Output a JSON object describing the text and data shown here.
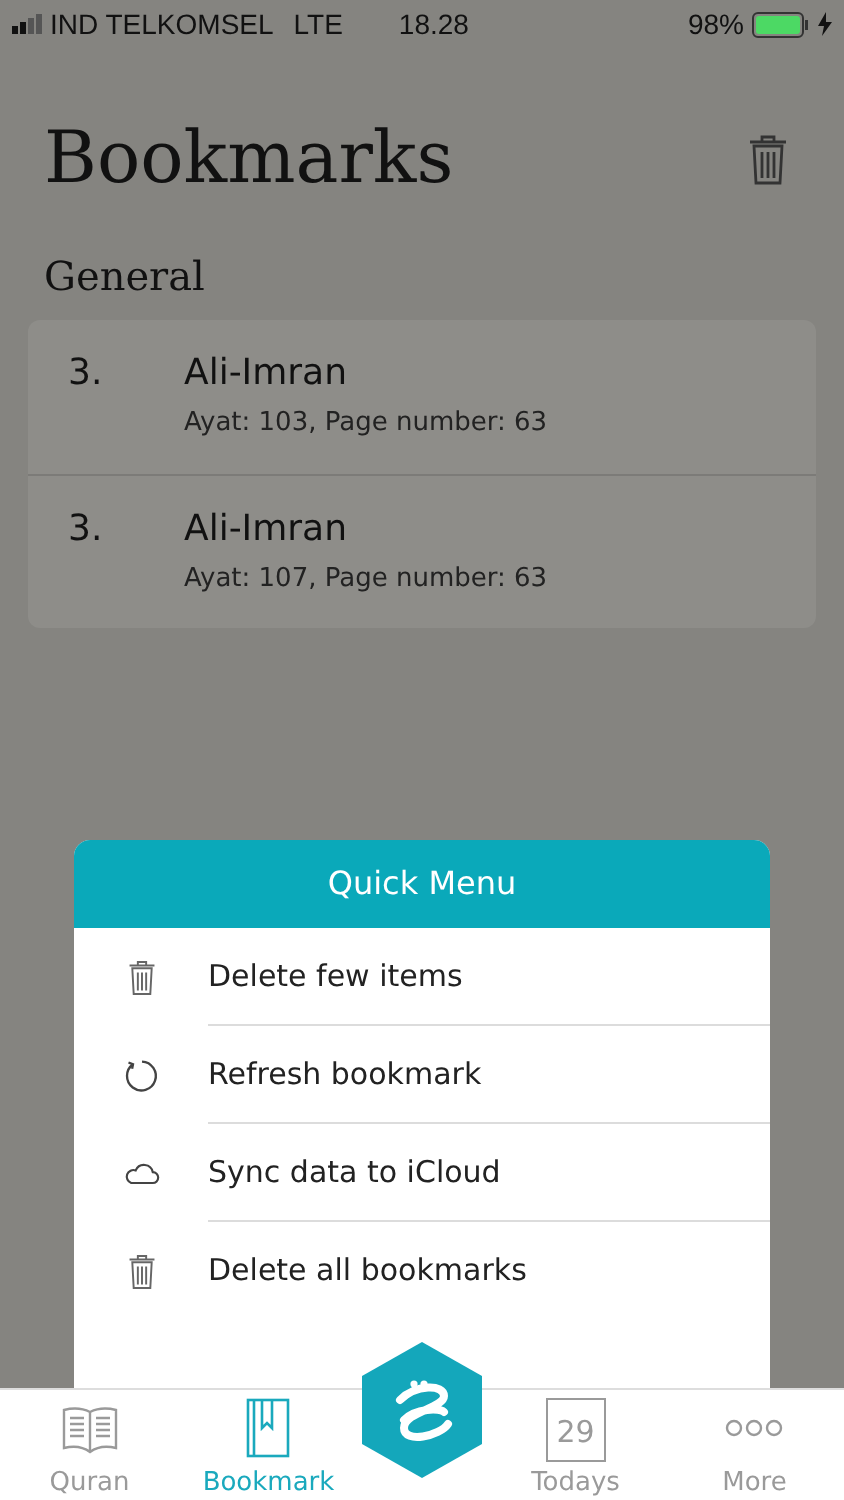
{
  "status_bar": {
    "carrier": "IND TELKOMSEL",
    "network": "LTE",
    "time": "18.28",
    "battery": "98%"
  },
  "header": {
    "title": "Bookmarks"
  },
  "section": {
    "title": "General"
  },
  "bookmarks": [
    {
      "number": "3.",
      "surah": "Ali-Imran",
      "detail": "Ayat: 103, Page number: 63"
    },
    {
      "number": "3.",
      "surah": "Ali-Imran",
      "detail": "Ayat: 107, Page number: 63"
    }
  ],
  "quick_menu": {
    "title": "Quick Menu",
    "items": [
      {
        "kind": "trash",
        "label": "Delete few items"
      },
      {
        "kind": "refresh",
        "label": "Refresh bookmark"
      },
      {
        "kind": "cloud",
        "label": "Sync data to iCloud"
      },
      {
        "kind": "trash",
        "label": "Delete all bookmarks"
      }
    ]
  },
  "tab_bar": {
    "tabs": [
      {
        "kind": "book",
        "label": "Quran",
        "selected": false
      },
      {
        "kind": "bookmark",
        "label": "Bookmark",
        "selected": true
      },
      {
        "kind": "calendar",
        "label": "Todays",
        "selected": false,
        "calendar_day": "29"
      },
      {
        "kind": "more",
        "label": "More",
        "selected": false
      }
    ]
  }
}
